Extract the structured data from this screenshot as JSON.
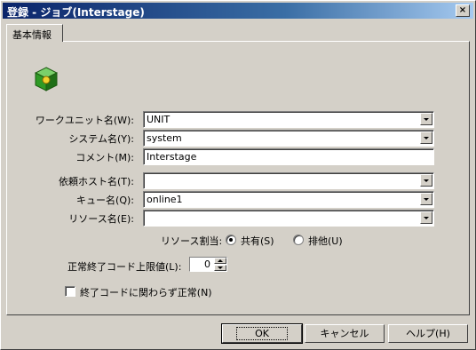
{
  "window": {
    "title": "登録 - ジョブ(Interstage)",
    "close_glyph": "×"
  },
  "tab": {
    "label": "基本情報"
  },
  "icon": "green-cube-icon",
  "fields": {
    "work_unit": {
      "label": "ワークユニット名(W):",
      "value": "UNIT"
    },
    "system": {
      "label": "システム名(Y):",
      "value": "system"
    },
    "comment": {
      "label": "コメント(M):",
      "value": "Interstage"
    },
    "host": {
      "label": "依頼ホスト名(T):",
      "value": ""
    },
    "queue": {
      "label": "キュー名(Q):",
      "value": "online1"
    },
    "resource": {
      "label": "リソース名(E):",
      "value": ""
    }
  },
  "resource_alloc": {
    "label": "リソース割当:",
    "options": [
      {
        "label": "共有(S)",
        "selected": true
      },
      {
        "label": "排他(U)",
        "selected": false
      }
    ]
  },
  "exit_code": {
    "label": "正常終了コード上限値(L):",
    "value": "0"
  },
  "always_normal": {
    "label": "終了コードに関わらず正常(N)",
    "checked": false
  },
  "buttons": {
    "ok": "OK",
    "cancel": "キャンセル",
    "help": "ヘルプ(H)"
  }
}
